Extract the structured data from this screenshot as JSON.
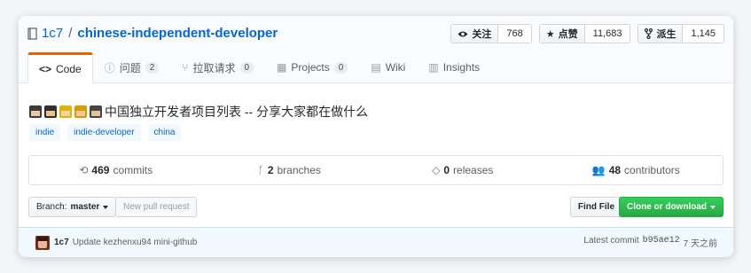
{
  "repo": {
    "owner": "1c7",
    "separator": "/",
    "name": "chinese-independent-developer"
  },
  "actions": [
    {
      "icon": "eye-icon",
      "label": "关注",
      "count": "768"
    },
    {
      "icon": "star-icon",
      "label": "点赞",
      "count": "11,683"
    },
    {
      "icon": "fork-icon",
      "label": "派生",
      "count": "1,145"
    }
  ],
  "tabs": [
    {
      "icon": "code-icon",
      "glyph": "<>",
      "label": "Code",
      "badge": ""
    },
    {
      "icon": "issue-icon",
      "glyph": "ⓘ",
      "label": "问题",
      "badge": "2"
    },
    {
      "icon": "pull-request-icon",
      "glyph": "⑂",
      "label": "拉取请求",
      "badge": "0"
    },
    {
      "icon": "project-icon",
      "glyph": "▦",
      "label": "Projects",
      "badge": "0"
    },
    {
      "icon": "wiki-icon",
      "glyph": "▤",
      "label": "Wiki",
      "badge": ""
    },
    {
      "icon": "insights-icon",
      "glyph": "▥",
      "label": "Insights",
      "badge": ""
    }
  ],
  "description": "中国独立开发者项目列表 -- 分享大家都在做什么",
  "topics": [
    "indie",
    "indie-developer",
    "china"
  ],
  "stats": [
    {
      "icon": "history-icon",
      "glyph": "⟲",
      "value": "469",
      "label": "commits"
    },
    {
      "icon": "branch-icon",
      "glyph": "ᚴ",
      "value": "2",
      "label": "branches"
    },
    {
      "icon": "tag-icon",
      "glyph": "◇",
      "value": "0",
      "label": "releases"
    },
    {
      "icon": "people-icon",
      "glyph": "👥",
      "value": "48",
      "label": "contributors"
    }
  ],
  "toolbar": {
    "branch_prefix": "Branch:",
    "branch_name": "master",
    "new_pr": "New pull request",
    "find_file": "Find File",
    "clone": "Clone or download"
  },
  "commit": {
    "author": "1c7",
    "message": "Update kezhenxu94 mini-github",
    "latest_label": "Latest commit",
    "sha": "b95ae12",
    "time": "7 天之前"
  },
  "colors": {
    "link": "#0366d6",
    "active_tab_accent": "#e36209",
    "clone_green": "#28a745"
  }
}
